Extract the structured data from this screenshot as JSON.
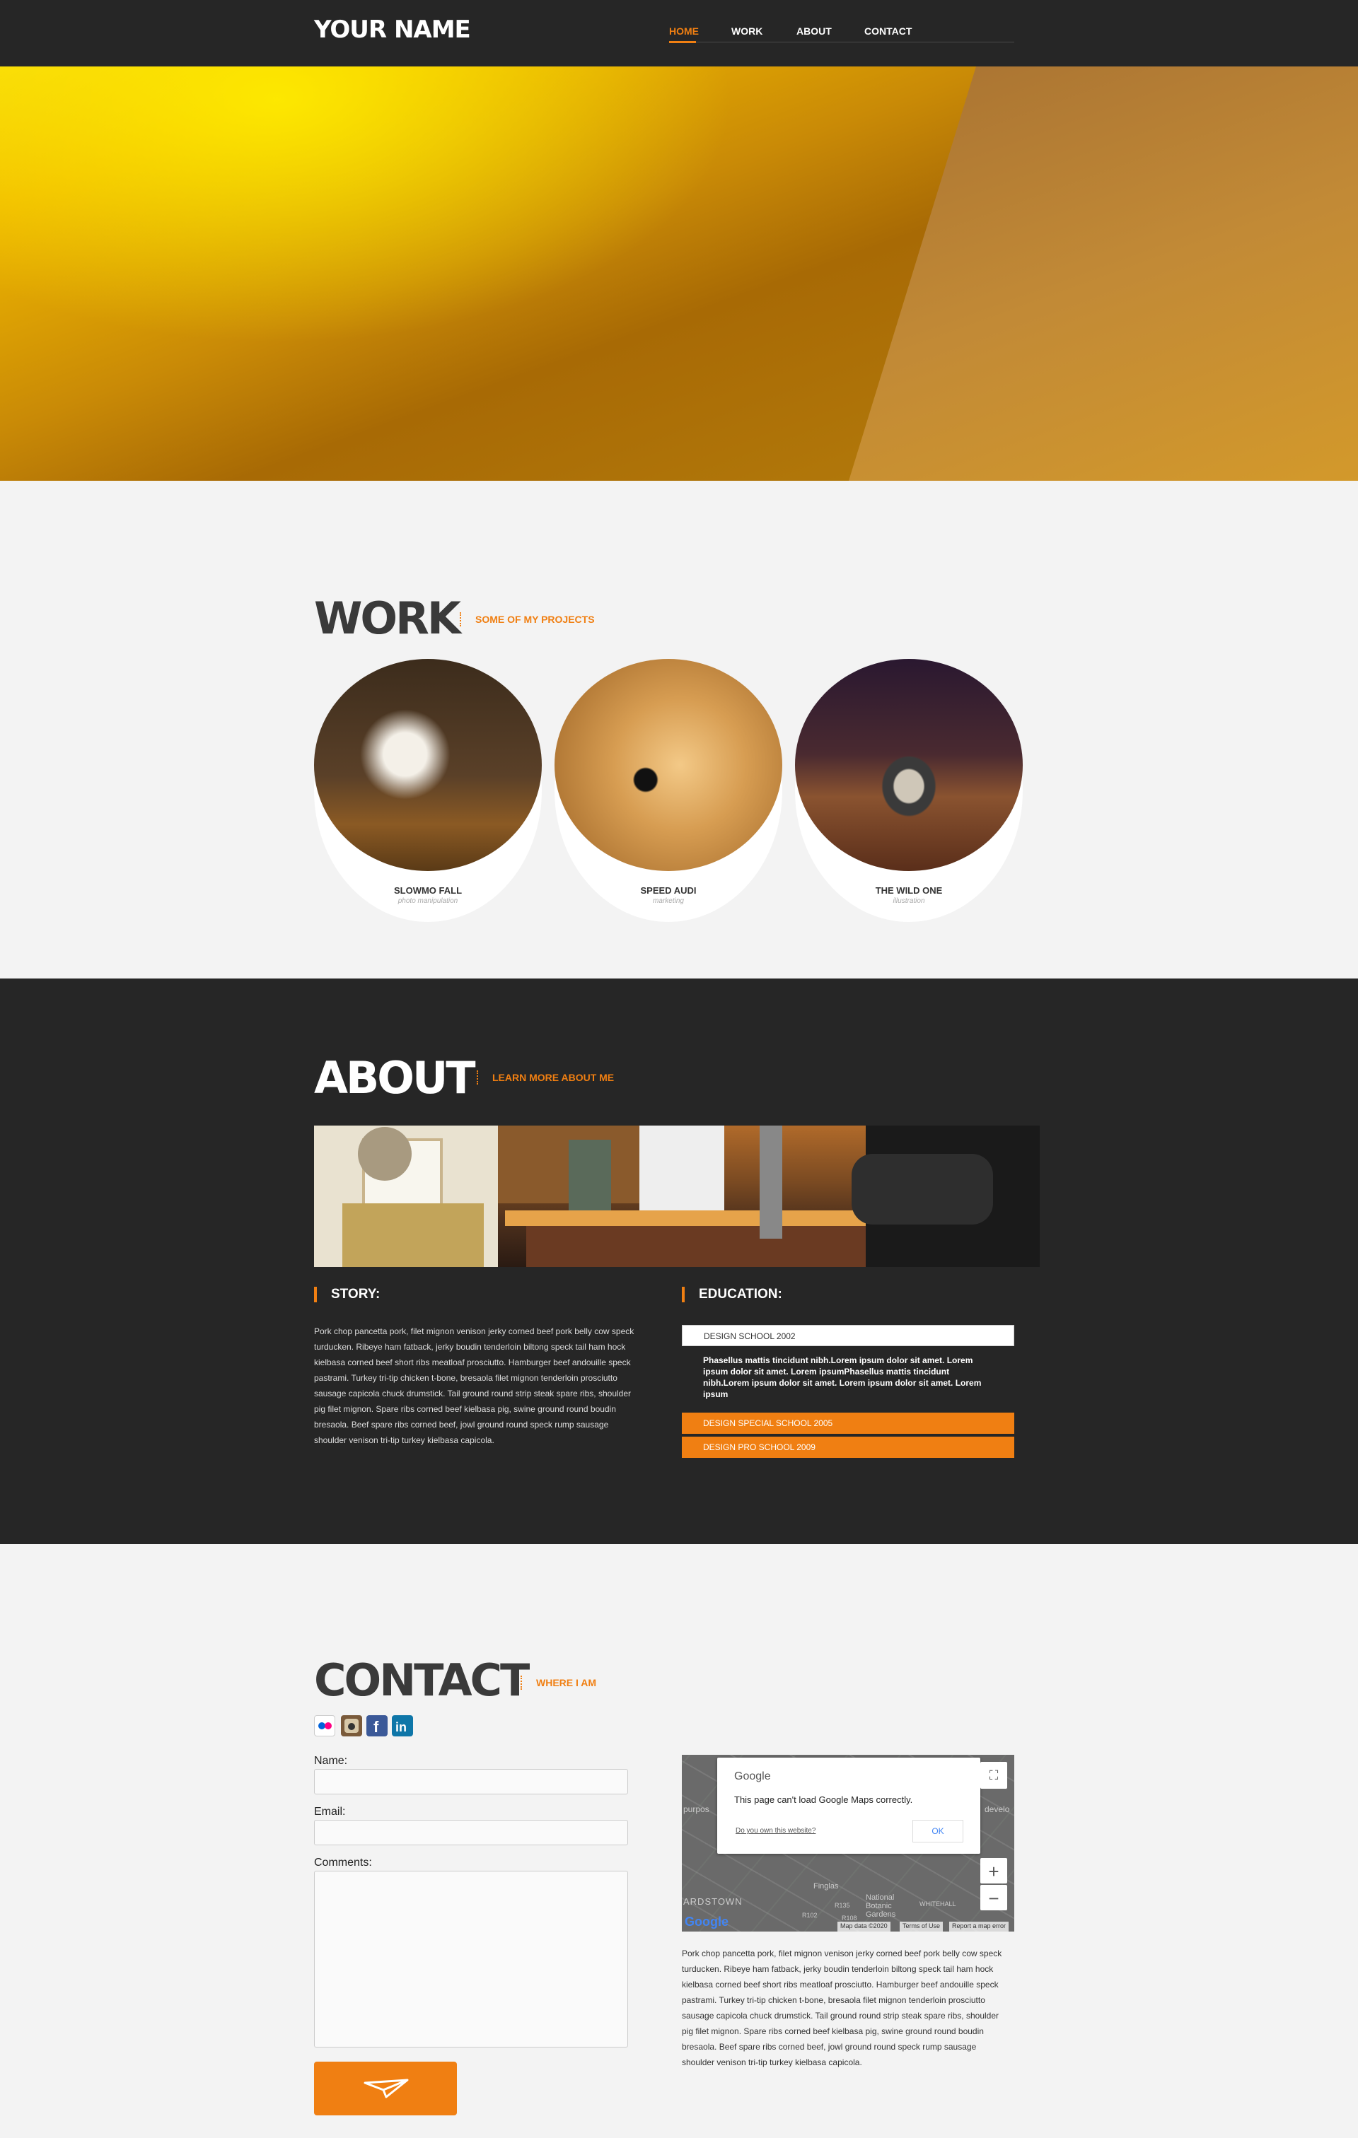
{
  "header": {
    "logo": "YOUR NAME",
    "nav": [
      "HOME",
      "WORK",
      "ABOUT",
      "CONTACT"
    ],
    "active": "HOME"
  },
  "work": {
    "title": "WORK",
    "subtitle": "SOME OF MY PROJECTS",
    "items": [
      {
        "title": "SLOWMO FALL",
        "category": "photo manipulation"
      },
      {
        "title": "SPEED AUDI",
        "category": "marketing"
      },
      {
        "title": "THE WILD ONE",
        "category": "illustration"
      }
    ]
  },
  "about": {
    "title": "ABOUT",
    "subtitle": "LEARN MORE ABOUT ME",
    "story_title": "STORY:",
    "story_text": "Pork chop pancetta pork, filet mignon venison jerky corned beef pork belly cow speck turducken. Ribeye ham fatback, jerky boudin tenderloin biltong speck tail ham hock kielbasa corned beef short ribs meatloaf prosciutto. Hamburger beef andouille speck pastrami. Turkey tri-tip chicken t-bone, bresaola filet mignon tenderloin prosciutto sausage capicola chuck drumstick. Tail ground round strip steak spare ribs, shoulder pig filet mignon. Spare ribs corned beef kielbasa pig, swine ground round boudin bresaola. Beef spare ribs corned beef, jowl ground round speck rump sausage shoulder venison tri-tip turkey kielbasa capicola.",
    "education_title": "EDUCATION:",
    "education": [
      {
        "label": "DESIGN SCHOOL 2002",
        "open": true,
        "text": "Phasellus mattis tincidunt nibh.Lorem ipsum dolor sit amet. Lorem ipsum dolor sit amet. Lorem ipsumPhasellus mattis tincidunt nibh.Lorem ipsum dolor sit amet. Lorem ipsum dolor sit amet. Lorem ipsum"
      },
      {
        "label": "DESIGN SPECIAL SCHOOL 2005",
        "open": false
      },
      {
        "label": "DESIGN PRO SCHOOL 2009",
        "open": false
      }
    ]
  },
  "contact": {
    "title": "CONTACT",
    "subtitle": "WHERE I AM",
    "social": [
      "flickr-icon",
      "instagram-icon",
      "facebook-icon",
      "linkedin-icon"
    ],
    "name_label": "Name:",
    "email_label": "Email:",
    "comments_label": "Comments:",
    "map": {
      "google": "Google",
      "error": "This page can't load Google Maps correctly.",
      "own_link": "Do you own this website?",
      "ok": "OK",
      "labels": [
        "purpos",
        "develo",
        "Finglas",
        "ARDSTOWN",
        "National Botanic Gardens",
        "WHITEHALL",
        "R135",
        "R108",
        "R102"
      ],
      "footer": [
        "Map data ©2020",
        "Terms of Use",
        "Report a map error"
      ]
    },
    "text": "Pork chop pancetta pork, filet mignon venison jerky corned beef pork belly cow speck turducken. Ribeye ham fatback, jerky boudin tenderloin biltong speck tail ham hock kielbasa corned beef short ribs meatloaf prosciutto. Hamburger beef andouille speck pastrami. Turkey tri-tip chicken t-bone, bresaola filet mignon tenderloin prosciutto sausage capicola chuck drumstick. Tail ground round strip steak spare ribs, shoulder pig filet mignon. Spare ribs corned beef kielbasa pig, swine ground round boudin bresaola. Beef spare ribs corned beef, jowl ground round speck rump sausage shoulder venison tri-tip turkey kielbasa capicola."
  },
  "colors": {
    "accent": "#f07f12",
    "dark": "#262626",
    "light": "#f3f3f3"
  }
}
